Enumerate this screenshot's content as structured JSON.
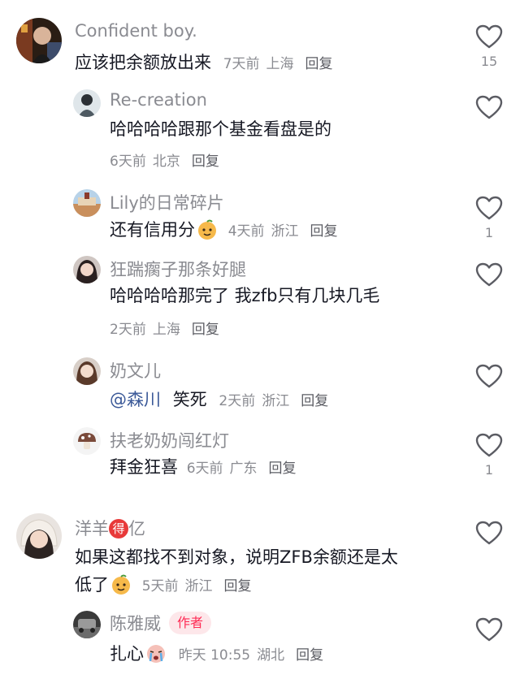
{
  "comments": [
    {
      "username": "Confident boy.",
      "text": "应该把余额放出来",
      "time": "7天前",
      "location": "上海",
      "reply_label": "回复",
      "likes": "15"
    },
    {
      "username": "Re-creation",
      "text": "哈哈哈哈跟那个基金看盘是的",
      "time": "6天前",
      "location": "北京",
      "reply_label": "回复"
    },
    {
      "username": "Lily的日常碎片",
      "text": "还有信用分",
      "time": "4天前",
      "location": "浙江",
      "reply_label": "回复",
      "likes": "1"
    },
    {
      "username": "狂踹瘸子那条好腿",
      "text": "哈哈哈哈那完了 我zfb只有几块几毛",
      "time": "2天前",
      "location": "上海",
      "reply_label": "回复"
    },
    {
      "username": "奶文儿",
      "mention": "@森川",
      "text": "笑死",
      "time": "2天前",
      "location": "浙江",
      "reply_label": "回复"
    },
    {
      "username": "扶老奶奶闯红灯",
      "text": "拜金狂喜",
      "time": "6天前",
      "location": "广东",
      "reply_label": "回复",
      "likes": "1"
    },
    {
      "username_part1": "洋羊",
      "badge": "得",
      "username_part2": "亿",
      "text_line1": "如果这都找不到对象，说明ZFB余额还是太",
      "text_line2": "低了",
      "time": "5天前",
      "location": "浙江",
      "reply_label": "回复"
    },
    {
      "username": "陈雅威",
      "author_tag": "作者",
      "text": "扎心",
      "time": "昨天 10:55",
      "location": "湖北",
      "reply_label": "回复"
    }
  ],
  "colors": {
    "accent": "#fe2c55",
    "meta": "#8a8b91",
    "text": "#161823"
  },
  "icons": [
    "heart-outline-icon",
    "mango-emoji-icon",
    "crying-emoji-icon",
    "mushroom-avatar-icon"
  ]
}
